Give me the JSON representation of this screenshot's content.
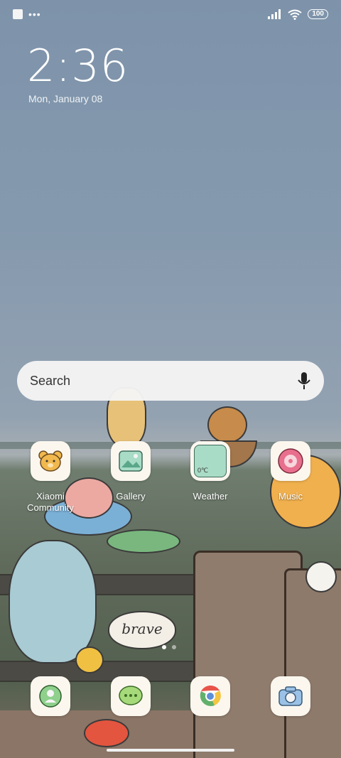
{
  "status_bar": {
    "battery": "100"
  },
  "lockclock": {
    "time": "2:36",
    "date": "Mon, January 08"
  },
  "search": {
    "placeholder": "Search"
  },
  "apps": [
    {
      "label": "Xiaomi Community",
      "icon": "bear-face-icon"
    },
    {
      "label": "Gallery",
      "icon": "gallery-icon"
    },
    {
      "label": "Weather",
      "icon": "weather-icon",
      "temp": "0℃"
    },
    {
      "label": "Music",
      "icon": "music-icon"
    }
  ],
  "dock": [
    {
      "icon": "phone-contact-icon"
    },
    {
      "icon": "message-icon"
    },
    {
      "icon": "chrome-icon"
    },
    {
      "icon": "camera-icon"
    }
  ],
  "wallpaper": {
    "text": "brave"
  },
  "page_indicator": {
    "pages": 2,
    "active": 1
  }
}
